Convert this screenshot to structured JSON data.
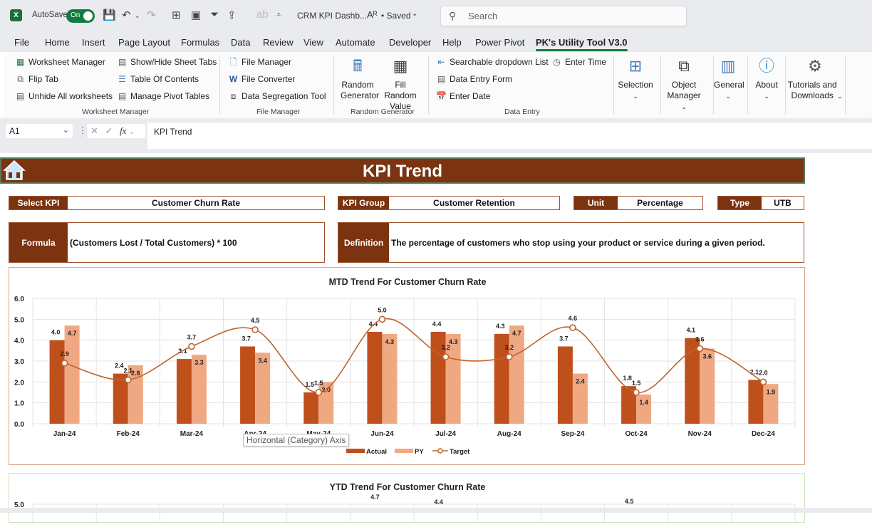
{
  "titlebar": {
    "autosave_label": "AutoSave",
    "autosave_state": "On",
    "document_title": "CRM KPI Dashb...",
    "save_status": "• Saved",
    "search_placeholder": "Search"
  },
  "menu": {
    "tabs": [
      "File",
      "Home",
      "Insert",
      "Page Layout",
      "Formulas",
      "Data",
      "Review",
      "View",
      "Automate",
      "Developer",
      "Help",
      "Power Pivot",
      "PK's Utility Tool V3.0"
    ],
    "active": "PK's Utility Tool V3.0"
  },
  "ribbon": {
    "worksheet_manager": {
      "label": "Worksheet Manager",
      "items": [
        "Worksheet Manager",
        "Flip Tab",
        "Unhide All worksheets",
        "Show/Hide Sheet Tabs",
        "Table Of Contents",
        "Manage Pivot Tables"
      ]
    },
    "file_manager": {
      "label": "File Manager",
      "items": [
        "File Manager",
        "File Converter",
        "Data Segregation Tool"
      ]
    },
    "random_generator": {
      "label": "Random Generator",
      "items": [
        "Random Generator",
        "Fill Random Value"
      ]
    },
    "data_entry": {
      "label": "Data Entry",
      "items": [
        "Searchable dropdown List",
        "Data Entry Form",
        "Enter Date",
        "Enter Time"
      ]
    },
    "large_buttons": [
      "Selection",
      "Object Manager",
      "General",
      "About",
      "Tutorials and Downloads"
    ]
  },
  "formula_bar": {
    "cell_ref": "A1",
    "content": "KPI Trend"
  },
  "dashboard": {
    "title": "KPI Trend",
    "select_kpi_label": "Select KPI",
    "select_kpi_value": "Customer Churn Rate",
    "kpi_group_label": "KPI Group",
    "kpi_group_value": "Customer Retention",
    "unit_label": "Unit",
    "unit_value": "Percentage",
    "type_label": "Type",
    "type_value": "UTB",
    "formula_label": "Formula",
    "formula_value": "(Customers Lost / Total Customers) * 100",
    "definition_label": "Definition",
    "definition_value": "The percentage of customers who stop using your product or service during a given period.",
    "tooltip": "Horizontal (Category) Axis"
  },
  "colors": {
    "header_brown": "#7b3310",
    "actual": "#c0501b",
    "py": "#f0a882",
    "target": "#c0632c"
  },
  "chart_data": [
    {
      "type": "bar",
      "title": "MTD Trend For Customer Churn Rate",
      "categories": [
        "Jan-24",
        "Feb-24",
        "Mar-24",
        "Apr-24",
        "May-24",
        "Jun-24",
        "Jul-24",
        "Aug-24",
        "Sep-24",
        "Oct-24",
        "Nov-24",
        "Dec-24"
      ],
      "series": [
        {
          "name": "Actual",
          "kind": "bar",
          "values": [
            4.0,
            2.4,
            3.1,
            3.7,
            1.5,
            4.4,
            4.4,
            4.3,
            3.7,
            1.8,
            4.1,
            2.1
          ]
        },
        {
          "name": "PY",
          "kind": "bar",
          "values": [
            4.7,
            2.8,
            3.3,
            3.4,
            2.0,
            4.3,
            4.3,
            4.7,
            2.4,
            1.4,
            3.6,
            1.9
          ]
        },
        {
          "name": "Target",
          "kind": "line",
          "values": [
            2.9,
            2.1,
            3.7,
            4.5,
            1.5,
            5.0,
            3.2,
            3.2,
            4.6,
            1.5,
            3.6,
            2.0
          ]
        }
      ],
      "yticks": [
        "0.0",
        "1.0",
        "2.0",
        "3.0",
        "4.0",
        "5.0",
        "6.0"
      ],
      "ylim": [
        0,
        6
      ],
      "xlabel": "",
      "ylabel": "",
      "grid": true,
      "legend": "bottom"
    },
    {
      "type": "bar",
      "title": "YTD Trend For Customer Churn Rate",
      "yticks_visible": [
        "5.0"
      ],
      "visible_labels": [
        "4.7",
        "4.4",
        "4.5"
      ]
    }
  ]
}
